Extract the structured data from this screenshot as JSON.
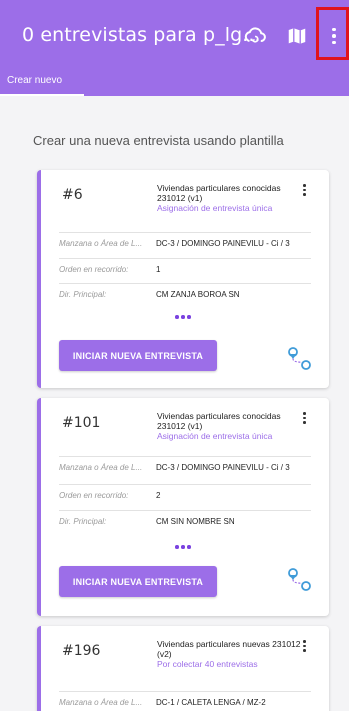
{
  "header": {
    "title": "0 entrevistas para p_lg...",
    "icons": [
      "cloud-sync-icon",
      "map-icon",
      "more-vert-icon"
    ]
  },
  "tabs": [
    {
      "label": "Crear nuevo",
      "active": true
    }
  ],
  "main": {
    "heading": "Crear una nueva entrevista usando plantilla"
  },
  "cards": [
    {
      "number": "#6",
      "desc": "Viviendas particulares conocidas 231012 (v1)",
      "sub": "Asignación de entrevista única",
      "rows": [
        {
          "label": "Manzana o Área de L...",
          "value": "DC-3 / DOMINGO PAINEVILU - Ci / 3"
        },
        {
          "label": "Orden en recorrido:",
          "value": "1"
        },
        {
          "label": "Dir. Principal:",
          "value": "CM ZANJA BOROA SN"
        }
      ],
      "button": "INICIAR NUEVA ENTREVISTA"
    },
    {
      "number": "#101",
      "desc": "Viviendas particulares conocidas 231012 (v1)",
      "sub": "Asignación de entrevista única",
      "rows": [
        {
          "label": "Manzana o Área de L...",
          "value": "DC-3 / DOMINGO PAINEVILU - Ci / 3"
        },
        {
          "label": "Orden en recorrido:",
          "value": "2"
        },
        {
          "label": "Dir. Principal:",
          "value": "CM SIN NOMBRE SN"
        }
      ],
      "button": "INICIAR NUEVA ENTREVISTA"
    },
    {
      "number": "#196",
      "desc": "Viviendas particulares nuevas 231012 (v2)",
      "sub": "Por colectar 40 entrevistas",
      "rows": [
        {
          "label": "Manzana o Área de L...",
          "value": "DC-1 / CALETA LENGA / MZ-2"
        }
      ]
    }
  ],
  "colors": {
    "accent": "#9c6ee8",
    "highlight": "#e0141c",
    "dots": "#7a42e0"
  }
}
